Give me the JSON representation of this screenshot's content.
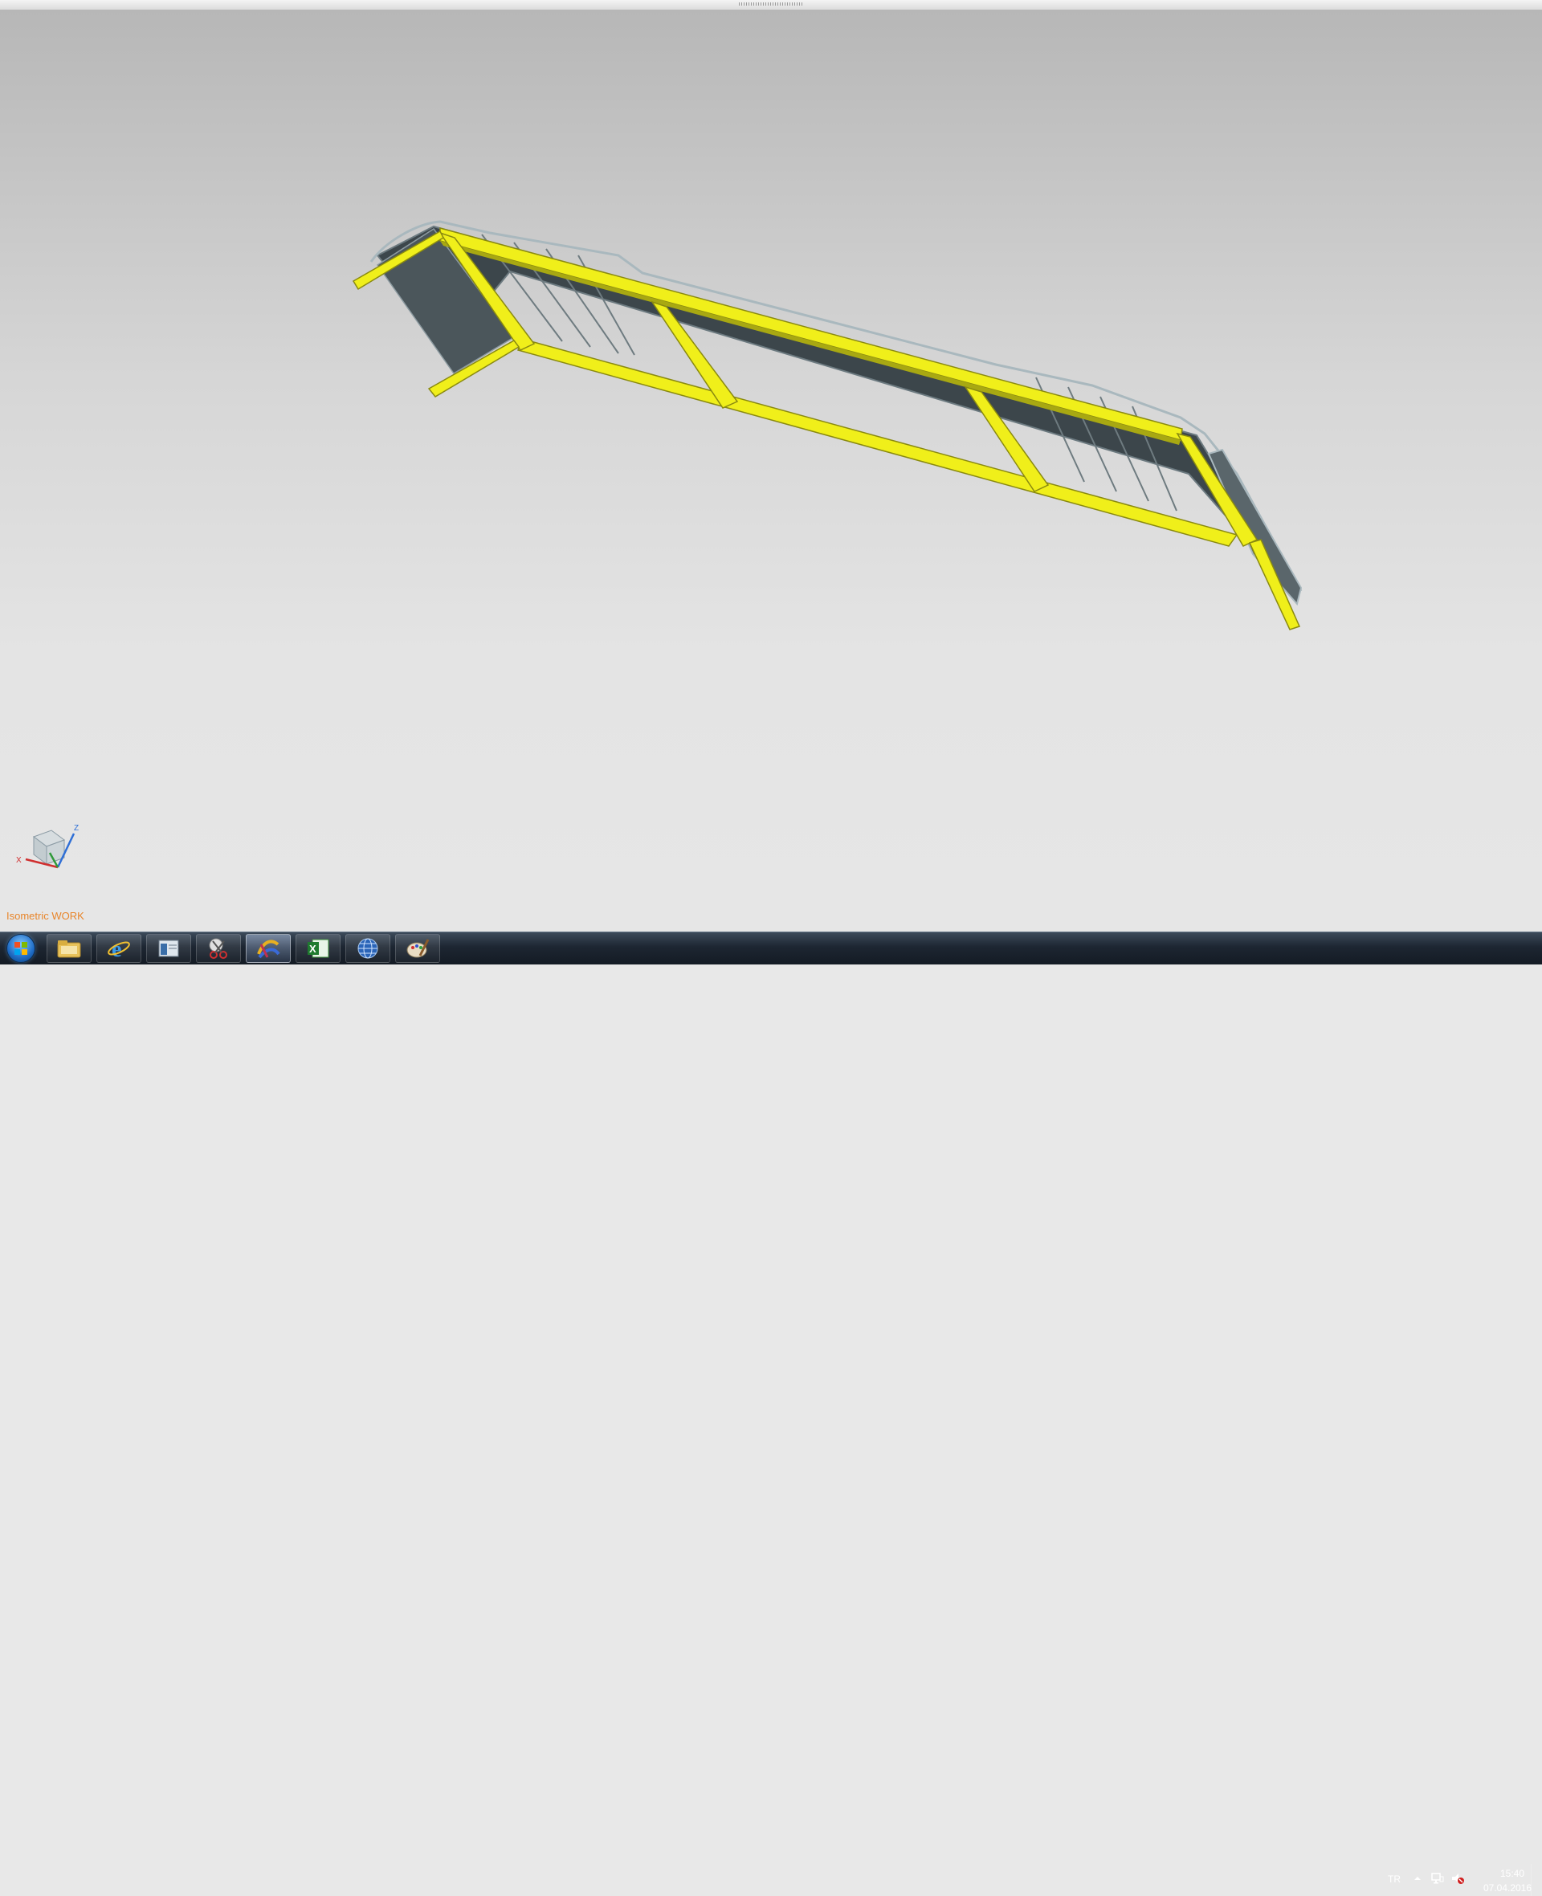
{
  "viewport": {
    "view_label": "Isometric WORK",
    "triad_labels": {
      "x": "X",
      "z": "Z"
    }
  },
  "colors": {
    "frame": "#f0ef1a",
    "frame_dark": "#9a9a10",
    "panel": "#3a4347"
  },
  "taskbar": {
    "apps": [
      {
        "name": "windows-explorer",
        "icon": "folder-icon",
        "active": false
      },
      {
        "name": "internet-explorer",
        "icon": "internet-explorer-icon",
        "active": false
      },
      {
        "name": "window",
        "icon": "window-icon",
        "active": false
      },
      {
        "name": "snipping-tool",
        "icon": "scissors-icon",
        "active": false
      },
      {
        "name": "nx",
        "icon": "nx-icon",
        "active": true
      },
      {
        "name": "excel",
        "icon": "excel-icon",
        "active": false
      },
      {
        "name": "globe-app",
        "icon": "globe-icon",
        "active": false
      },
      {
        "name": "paint",
        "icon": "paint-icon",
        "active": false
      }
    ]
  },
  "tray": {
    "language": "TR",
    "time": "15:40",
    "date": "07.04.2016"
  }
}
